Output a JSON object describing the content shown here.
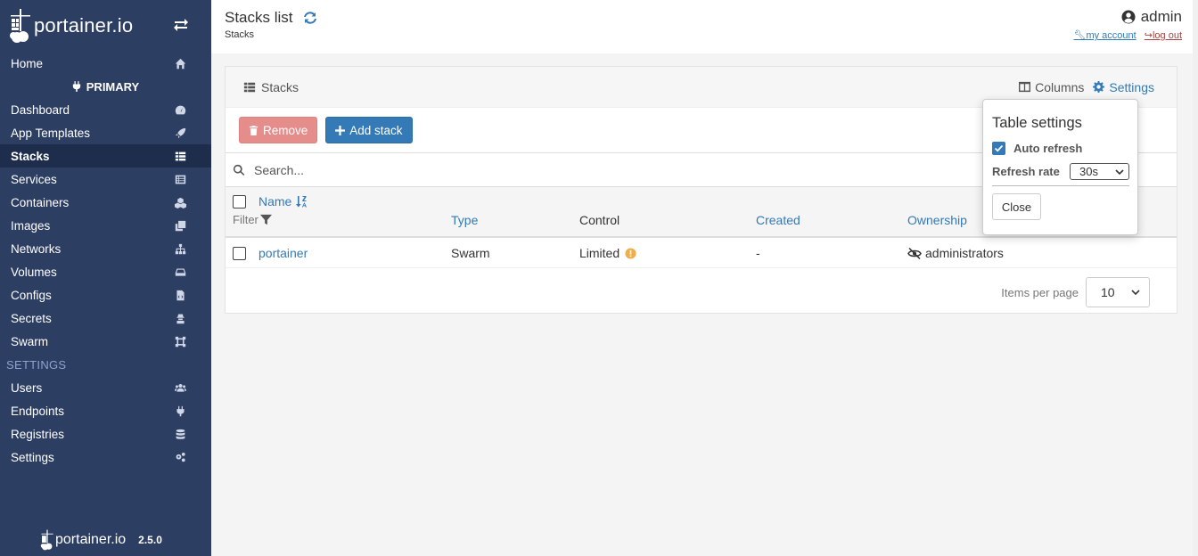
{
  "brand": {
    "name": "portainer.io",
    "version": "2.5.0"
  },
  "sidebar": {
    "home": "Home",
    "endpoint_header": "PRIMARY",
    "items": [
      {
        "label": "Dashboard",
        "icon": "dashboard-icon"
      },
      {
        "label": "App Templates",
        "icon": "rocket-icon"
      },
      {
        "label": "Stacks",
        "icon": "list-icon",
        "active": true
      },
      {
        "label": "Services",
        "icon": "list-alt-icon"
      },
      {
        "label": "Containers",
        "icon": "cubes-icon"
      },
      {
        "label": "Images",
        "icon": "clone-icon"
      },
      {
        "label": "Networks",
        "icon": "sitemap-icon"
      },
      {
        "label": "Volumes",
        "icon": "hdd-icon"
      },
      {
        "label": "Configs",
        "icon": "file-code-icon"
      },
      {
        "label": "Secrets",
        "icon": "user-secret-icon"
      },
      {
        "label": "Swarm",
        "icon": "object-group-icon"
      }
    ],
    "settings_section": "SETTINGS",
    "settings_items": [
      {
        "label": "Users",
        "icon": "users-icon"
      },
      {
        "label": "Endpoints",
        "icon": "plug-icon"
      },
      {
        "label": "Registries",
        "icon": "database-icon"
      },
      {
        "label": "Settings",
        "icon": "cogs-icon"
      }
    ]
  },
  "header": {
    "title": "Stacks list",
    "breadcrumb": "Stacks",
    "username": "admin",
    "my_account": "my account",
    "log_out": "log out"
  },
  "panel": {
    "title": "Stacks",
    "columns_label": "Columns",
    "settings_label": "Settings",
    "remove_label": "Remove",
    "add_label": "Add stack",
    "search_placeholder": "Search...",
    "filter_label": "Filter",
    "headers": {
      "name": "Name",
      "type": "Type",
      "control": "Control",
      "created": "Created",
      "ownership": "Ownership"
    },
    "rows": [
      {
        "name": "portainer",
        "type": "Swarm",
        "control": "Limited",
        "created": "-",
        "ownership": "administrators"
      }
    ],
    "items_per_page_label": "Items per page",
    "items_per_page": "10"
  },
  "table_settings": {
    "title": "Table settings",
    "auto_refresh_label": "Auto refresh",
    "auto_refresh_checked": true,
    "refresh_rate_label": "Refresh rate",
    "refresh_rate": "30s",
    "close_label": "Close"
  },
  "colors": {
    "sidebar": "#2d3e63",
    "accent": "#337ab7",
    "remove": "#e58d8b",
    "warning": "#f0ad4e"
  }
}
